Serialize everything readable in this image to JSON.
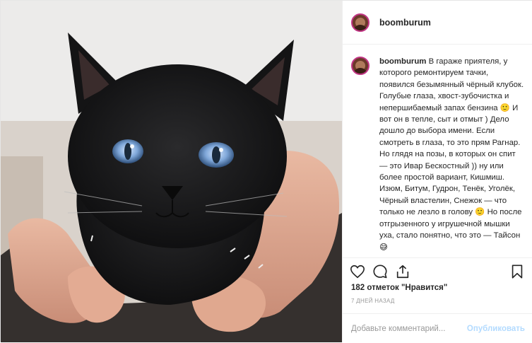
{
  "post": {
    "username": "boomburum",
    "image_alt": "black kitten with blue eyes held in hands"
  },
  "caption": {
    "username": "boomburum",
    "text": "В гараже приятеля, у которого ремонтируем тачки, появился безымянный чёрный клубок. Голубые глаза, хвост-зубочистка и непершибаемый запах бензина 🙂 И вот он в тепле, сыт и отмыт ) Дело дошло до выбора имени. Если смотреть в глаза, то это прям Рагнар. Но глядя на позы, в которых он спит — это Ивар Бескостный )) ну или более простой вариант, Кишмиш. Изюм, Битум, Гудрон, Тенёк, Уголёк, Чёрный властелин, Снежок — что только не лезло в голову 🙂 Но после отгрызенного у игрушечной мышки уха, стало понятно, что это — Тайсон 😅"
  },
  "actions": {
    "like_icon": "heart-icon",
    "comment_icon": "comment-icon",
    "share_icon": "share-icon",
    "save_icon": "bookmark-icon",
    "likes_text": "182 отметок \"Нравится\"",
    "time_ago": "7 ДНЕЙ НАЗАД"
  },
  "add_comment": {
    "placeholder": "Добавьте комментарий...",
    "publish_label": "Опубликовать"
  },
  "colors": {
    "text": "#262626",
    "muted": "#999999",
    "publish_disabled": "#b3dbff",
    "border": "#efefef",
    "avatar_ring": "#c13584",
    "kitten_eye": "#7fa7d9"
  }
}
